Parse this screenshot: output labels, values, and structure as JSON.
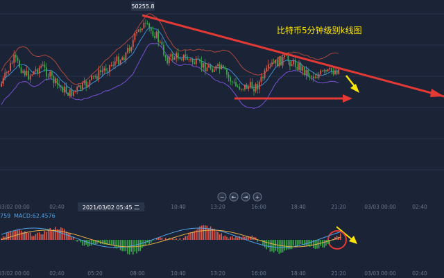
{
  "chart_data": {
    "type": "candlestick",
    "title": "比特币5分钟级别k线图",
    "price_marker": "50255.8",
    "time_axis_top": [
      "03/02 00:00",
      "02:40",
      "05:20",
      "08:00",
      "10:40",
      "13:20",
      "16:00",
      "18:40",
      "21:20",
      "03/03 00:00",
      "02:40"
    ],
    "time_axis_bottom": [
      "03/02 00:00",
      "02:40",
      "05:20",
      "08:00",
      "10:40",
      "13:20",
      "16:00",
      "18:40",
      "21:20",
      "03/03 00:00",
      "02:40"
    ],
    "cursor_time": "2021/03/02 05:45 二",
    "macd_label_left": "759",
    "macd_label": "MACD:62.4576",
    "zoom_controls": [
      "−",
      "⇤",
      "⇥",
      "+"
    ],
    "annotations": [
      "downtrend-line",
      "support-line",
      "breakdown-arrow",
      "circled-macd"
    ],
    "colors": {
      "background": "#1b2436",
      "up": "#e05a4c",
      "down": "#3aa84a",
      "upper_band": "#b0473d",
      "lower_band": "#7a4fd6",
      "mid_band": "#3b8fd9",
      "ma_fast": "#e8b34a",
      "ma_slow": "#4fa3e8",
      "annotation_red": "#e53935",
      "annotation_yellow": "#ffe600",
      "title": "#ffe600"
    }
  }
}
